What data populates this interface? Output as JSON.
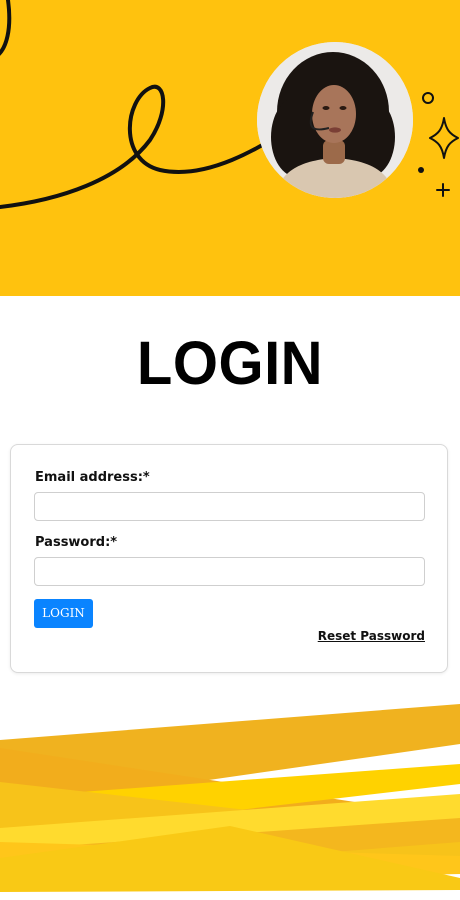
{
  "page": {
    "title": "LOGIN"
  },
  "form": {
    "email_label": "Email address:*",
    "email_value": "",
    "password_label": "Password:*",
    "password_value": "",
    "login_button": "LOGIN",
    "reset_link": "Reset Password"
  },
  "colors": {
    "brand_yellow": "#ffc20e",
    "button_blue": "#0a84ff"
  },
  "icons": [
    "sparkle-icon",
    "circle-doodle-icon",
    "plus-icon",
    "dot-icon"
  ]
}
